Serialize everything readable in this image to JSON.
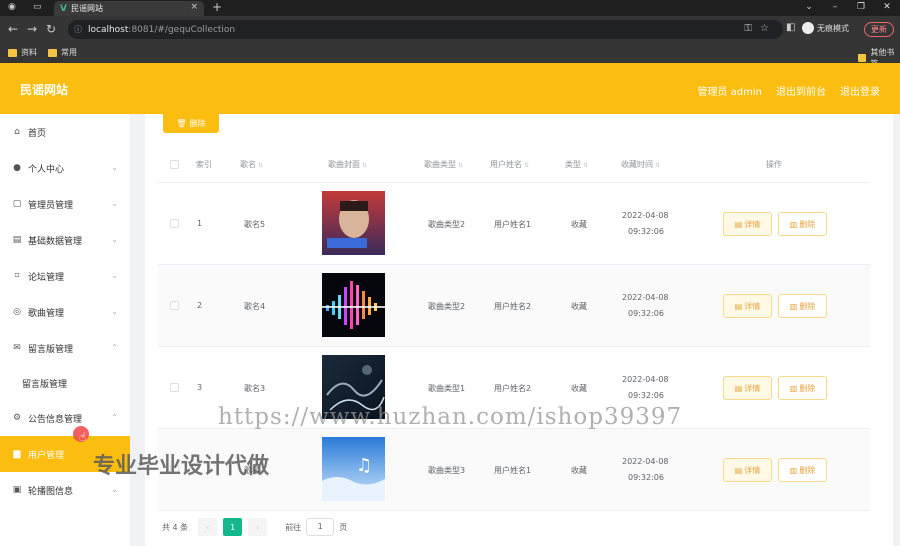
{
  "browser": {
    "tab_title": "民谣网站",
    "url_host": "localhost",
    "url_rest": ":8081/#/gequCollection",
    "incognito_label": "无痕模式",
    "update_label": "更新",
    "bookmarks": [
      "资料",
      "常用"
    ],
    "other_bookmarks": "其他书签"
  },
  "header": {
    "site_title": "民谣网站",
    "admin_label": "管理员 admin",
    "exit_backend": "退出到前台",
    "logout": "退出登录"
  },
  "sidebar": {
    "items": [
      {
        "label": "首页",
        "icon": "home-icon"
      },
      {
        "label": "个人中心",
        "icon": "user-icon"
      },
      {
        "label": "管理员管理",
        "icon": "chat-icon"
      },
      {
        "label": "基础数据管理",
        "icon": "list-icon"
      },
      {
        "label": "论坛管理",
        "icon": "crop-icon"
      },
      {
        "label": "歌曲管理",
        "icon": "compass-icon"
      },
      {
        "label": "留言版管理",
        "icon": "mail-icon"
      },
      {
        "label": "留言版管理",
        "icon": ""
      },
      {
        "label": "公告信息管理",
        "icon": "gear-icon"
      },
      {
        "label": "用户管理",
        "icon": "doc-icon"
      },
      {
        "label": "轮播图信息",
        "icon": "briefcase-icon"
      }
    ]
  },
  "toolbar": {
    "delete_label": "删除"
  },
  "table": {
    "headers": [
      "索引",
      "歌名",
      "歌曲封面",
      "歌曲类型",
      "用户姓名",
      "类型",
      "收藏时间",
      "操作"
    ],
    "rows": [
      {
        "index": "1",
        "name": "歌名5",
        "genre": "歌曲类型2",
        "user": "用户姓名1",
        "type": "收藏",
        "date": "2022-04-08",
        "time": "09:32:06"
      },
      {
        "index": "2",
        "name": "歌名4",
        "genre": "歌曲类型2",
        "user": "用户姓名2",
        "type": "收藏",
        "date": "2022-04-08",
        "time": "09:32:06"
      },
      {
        "index": "3",
        "name": "歌名3",
        "genre": "歌曲类型1",
        "user": "用户姓名2",
        "type": "收藏",
        "date": "2022-04-08",
        "time": "09:32:06"
      },
      {
        "index": "",
        "name": "歌名",
        "genre": "歌曲类型3",
        "user": "用户姓名1",
        "type": "收藏",
        "date": "2022-04-08",
        "time": "09:32:06"
      }
    ],
    "detail_label": "详情",
    "delete_label": "删除"
  },
  "pagination": {
    "total": "共 4 条",
    "current_page": "1",
    "goto_label": "前往",
    "goto_value": "1",
    "page_unit": "页"
  },
  "watermark": {
    "url": "https://www.huzhan.com/ishop39397",
    "text": "专业毕业设计代做"
  },
  "colors": {
    "accent": "#fbbd0f",
    "page_active": "#13b98a",
    "warning": "#e6a23c"
  }
}
